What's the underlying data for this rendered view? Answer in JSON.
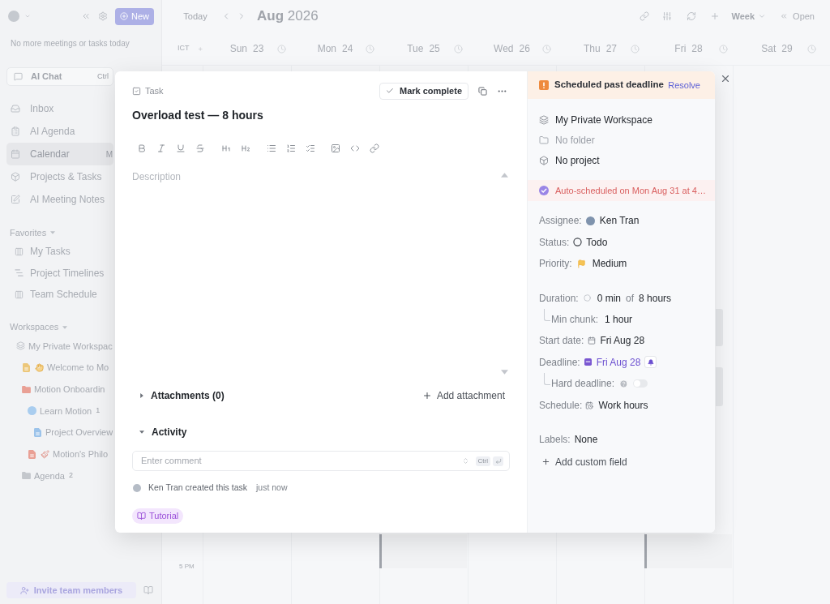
{
  "sidebar": {
    "new_button": "New",
    "today_note": "No more meetings or tasks today",
    "ai_chat": {
      "label": "AI Chat",
      "shortcut": "Ctrl"
    },
    "nav": [
      {
        "label": "Inbox",
        "selected": false
      },
      {
        "label": "AI Agenda",
        "selected": false
      },
      {
        "label": "Calendar",
        "shortcut": "M",
        "selected": true
      },
      {
        "label": "Projects & Tasks",
        "selected": false
      },
      {
        "label": "AI Meeting Notes",
        "selected": false
      }
    ],
    "favorites": {
      "title": "Favorites",
      "expanded": true,
      "items": [
        {
          "label": "My Tasks"
        },
        {
          "label": "Project Timelines"
        },
        {
          "label": "Team Schedule"
        }
      ]
    },
    "workspaces": {
      "title": "Workspaces",
      "expanded": true,
      "items": [
        {
          "kind": "workspace",
          "label": "My Private Workspac",
          "children": [
            {
              "kind": "doc",
              "label": "Welcome to Mo",
              "color": "#ecc77a",
              "emoji": true
            },
            {
              "kind": "folder",
              "label": "Motion Onboardin",
              "color": "#e9a095",
              "children": [
                {
                  "kind": "project",
                  "label": "Learn Motion",
                  "count": "1",
                  "color": "#a9cdef",
                  "children": [
                    {
                      "kind": "doc",
                      "label": "Project Overview",
                      "color": "#9cc3ea"
                    }
                  ]
                },
                {
                  "kind": "doc",
                  "label": "Motion's Philo",
                  "color": "#e9a095",
                  "emoji": true
                }
              ]
            },
            {
              "kind": "folder",
              "label": "Agenda",
              "count": "2",
              "color": "#c4c7cc"
            }
          ]
        }
      ]
    },
    "invite_button": "Invite team members"
  },
  "calendar": {
    "today_button": "Today",
    "month": "Aug",
    "year": "2026",
    "view": "Week",
    "open_button": "Open",
    "timezone": "ICT",
    "days": [
      {
        "weekday": "Sun",
        "date": "23"
      },
      {
        "weekday": "Mon",
        "date": "24"
      },
      {
        "weekday": "Tue",
        "date": "25"
      },
      {
        "weekday": "Wed",
        "date": "26"
      },
      {
        "weekday": "Thu",
        "date": "27"
      },
      {
        "weekday": "Fri",
        "date": "28"
      },
      {
        "weekday": "Sat",
        "date": "29"
      }
    ],
    "time_label": "5 PM"
  },
  "task": {
    "type_label": "Task",
    "mark_complete": "Mark complete",
    "title": "Overload test — 8 hours",
    "description_placeholder": "Description",
    "attachments": {
      "label": "Attachments (0)",
      "expanded": false,
      "add_button": "Add attachment"
    },
    "activity": {
      "label": "Activity",
      "expanded": true,
      "comment_placeholder": "Enter comment",
      "shortcut": "Ctrl",
      "log": [
        {
          "text": "Ken Tran created this task",
          "time": "just now"
        }
      ]
    },
    "tag": "Tutorial"
  },
  "details": {
    "alert": {
      "message": "Scheduled past deadline",
      "action": "Resolve"
    },
    "location": [
      {
        "label": "My Private Workspace",
        "muted": false
      },
      {
        "label": "No folder",
        "muted": true
      },
      {
        "label": "No project",
        "muted": false
      }
    ],
    "auto_scheduled": "Auto-scheduled on Mon Aug 31 at 4…",
    "people": [
      {
        "kind": "assignee",
        "label": "Assignee:",
        "value": "Ken Tran"
      },
      {
        "kind": "status",
        "label": "Status:",
        "value": "Todo"
      },
      {
        "kind": "priority",
        "label": "Priority:",
        "value": "Medium"
      }
    ],
    "timing": [
      {
        "kind": "duration",
        "label": "Duration:",
        "value": "0 min",
        "joiner": "of",
        "total": "8 hours"
      },
      {
        "kind": "sub",
        "label": "Min chunk:",
        "value": "1 hour"
      },
      {
        "kind": "start",
        "label": "Start date:",
        "value": "Fri Aug 28"
      },
      {
        "kind": "deadline",
        "label": "Deadline:",
        "value": "Fri Aug 28"
      },
      {
        "kind": "hard",
        "label": "Hard deadline:",
        "on": false
      },
      {
        "kind": "schedule",
        "label": "Schedule:",
        "value": "Work hours"
      }
    ],
    "labels": {
      "label": "Labels:",
      "value": "None"
    },
    "add_field": "Add custom field"
  }
}
